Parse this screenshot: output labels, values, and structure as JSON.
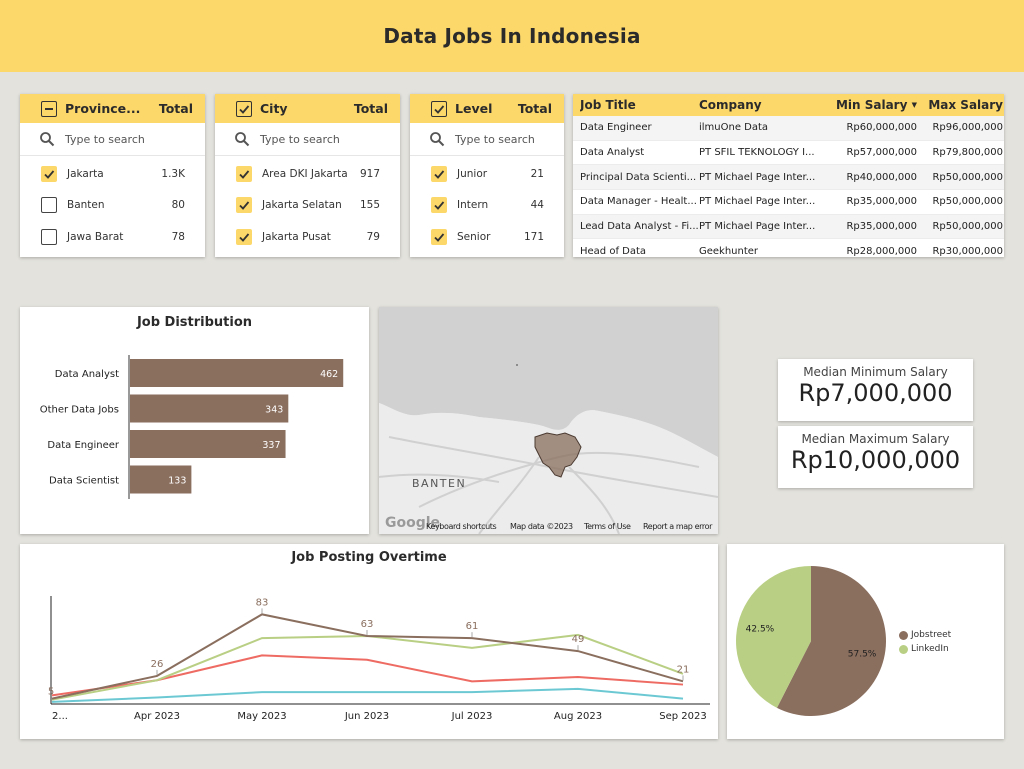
{
  "header": {
    "title": "Data Jobs In Indonesia"
  },
  "filters": [
    {
      "label": "Province...",
      "total_label": "Total",
      "header_check": "minus",
      "search_placeholder": "Type to search",
      "items": [
        {
          "label": "Jakarta",
          "value": "1.3K",
          "checked": true
        },
        {
          "label": "Banten",
          "value": "80",
          "checked": false
        },
        {
          "label": "Jawa Barat",
          "value": "78",
          "checked": false
        }
      ]
    },
    {
      "label": "City",
      "total_label": "Total",
      "header_check": "check",
      "search_placeholder": "Type to search",
      "items": [
        {
          "label": "Area DKI Jakarta",
          "value": "917",
          "checked": true
        },
        {
          "label": "Jakarta Selatan",
          "value": "155",
          "checked": true
        },
        {
          "label": "Jakarta Pusat",
          "value": "79",
          "checked": true
        }
      ]
    },
    {
      "label": "Level",
      "total_label": "Total",
      "header_check": "check",
      "search_placeholder": "Type to search",
      "items": [
        {
          "label": "Junior",
          "value": "21",
          "checked": true
        },
        {
          "label": "Intern",
          "value": "44",
          "checked": true
        },
        {
          "label": "Senior",
          "value": "171",
          "checked": true
        }
      ]
    }
  ],
  "job_table": {
    "headers": {
      "title": "Job Title",
      "company": "Company",
      "min": "Min Salary",
      "max": "Max Salary",
      "sort_glyph": "▼"
    },
    "rows": [
      {
        "title": "Data Engineer",
        "company": "ilmuOne Data",
        "min": "Rp60,000,000",
        "max": "Rp96,000,000"
      },
      {
        "title": "Data Analyst",
        "company": "PT SFIL TEKNOLOGY I...",
        "min": "Rp57,000,000",
        "max": "Rp79,800,000"
      },
      {
        "title": "Principal Data Scienti...",
        "company": "PT Michael Page Inter...",
        "min": "Rp40,000,000",
        "max": "Rp50,000,000"
      },
      {
        "title": "Data Manager - Healt...",
        "company": "PT Michael Page Inter...",
        "min": "Rp35,000,000",
        "max": "Rp50,000,000"
      },
      {
        "title": "Lead Data Analyst - Fi...",
        "company": "PT Michael Page Inter...",
        "min": "Rp35,000,000",
        "max": "Rp50,000,000"
      },
      {
        "title": "Head of Data",
        "company": "Geekhunter",
        "min": "Rp28,000,000",
        "max": "Rp30,000,000"
      }
    ]
  },
  "map": {
    "region_label": "BANTEN",
    "logo": "Google",
    "footer": [
      "Keyboard shortcuts",
      "Map data ©2023",
      "Terms of Use",
      "Report a map error"
    ],
    "highlight_color": "#8a6e5e"
  },
  "kpis": {
    "min_label": "Median Minimum Salary",
    "min_value": "Rp7,000,000",
    "max_label": "Median Maximum Salary",
    "max_value": "Rp10,000,000"
  },
  "colors": {
    "accent": "#fcd76a",
    "brown": "#8a6e5e",
    "green": "#b9cf84",
    "red": "#ee6b63",
    "teal": "#6cc9d3"
  },
  "chart_data": [
    {
      "type": "bar",
      "orientation": "horizontal",
      "title": "Job Distribution",
      "categories": [
        "Data Analyst",
        "Other Data Jobs",
        "Data Engineer",
        "Data Scientist"
      ],
      "values": [
        462,
        343,
        337,
        133
      ],
      "labels": [
        "462",
        "343",
        "337",
        "133"
      ],
      "xlim": [
        0,
        650
      ],
      "color": "#8a6e5e"
    },
    {
      "type": "line",
      "title": "Job Posting Overtime",
      "x": [
        "2...",
        "Apr 2023",
        "May 2023",
        "Jun 2023",
        "Jul 2023",
        "Aug 2023",
        "Sep 2023"
      ],
      "ylim": [
        0,
        100
      ],
      "series": [
        {
          "color": "#8a6e5e",
          "values": [
            5,
            26,
            83,
            63,
            61,
            49,
            21
          ],
          "labels": [
            "5",
            "26",
            "83",
            "63",
            "61",
            "49",
            "21"
          ]
        },
        {
          "color": "#b9cf84",
          "values": [
            4,
            22,
            61,
            63,
            52,
            64,
            28
          ]
        },
        {
          "color": "#ee6b63",
          "values": [
            8,
            22,
            45,
            41,
            21,
            25,
            18
          ]
        },
        {
          "color": "#6cc9d3",
          "values": [
            2,
            6,
            11,
            11,
            11,
            14,
            5
          ]
        }
      ]
    },
    {
      "type": "pie",
      "slices": [
        {
          "label": "Jobstreet",
          "value": 57.5,
          "text": "57.5%",
          "color": "#8a6e5e"
        },
        {
          "label": "LinkedIn",
          "value": 42.5,
          "text": "42.5%",
          "color": "#b9cf84"
        }
      ],
      "legend": "right"
    }
  ]
}
